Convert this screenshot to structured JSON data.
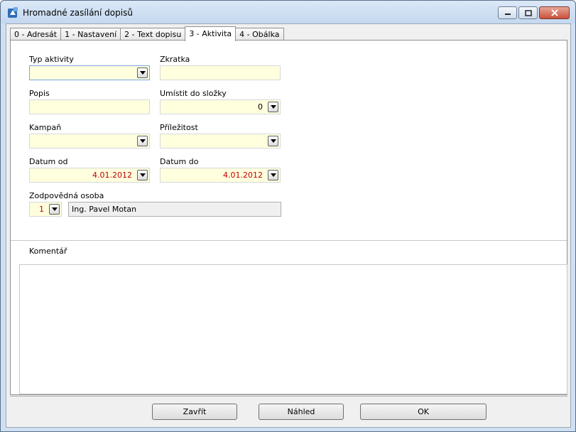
{
  "window": {
    "title": "Hromadné zasílání dopisů"
  },
  "tabs": [
    {
      "label": "0 - Adresát"
    },
    {
      "label": "1 - Nastavení"
    },
    {
      "label": "2 - Text dopisu"
    },
    {
      "label": "3 - Aktivita"
    },
    {
      "label": "4 - Obálka"
    }
  ],
  "active_tab": "3 - Aktivita",
  "form": {
    "typ_aktivity": {
      "label": "Typ aktivity",
      "value": ""
    },
    "zkratka": {
      "label": "Zkratka",
      "value": ""
    },
    "popis": {
      "label": "Popis",
      "value": ""
    },
    "umistit": {
      "label": "Umístit do složky",
      "value": "0"
    },
    "kampan": {
      "label": "Kampaň",
      "value": ""
    },
    "prilezitost": {
      "label": "Příležitost",
      "value": ""
    },
    "datum_od": {
      "label": "Datum od",
      "value": "4.01.2012"
    },
    "datum_do": {
      "label": "Datum do",
      "value": "4.01.2012"
    },
    "zodpovedna": {
      "label": "Zodpovědná osoba",
      "id": "1",
      "name": "Ing. Pavel Motan"
    },
    "komentar": {
      "label": "Komentář",
      "value": ""
    }
  },
  "buttons": {
    "zavrit": "Zavřít",
    "nahled": "Náhled",
    "ok": "OK"
  },
  "colors": {
    "field_bg": "#ffffde",
    "date_text": "#c00000",
    "title_bar": "#c4d8ef"
  },
  "icons": {
    "app": "app-icon",
    "dropdown": "chevron-down-icon",
    "minimize": "minimize-icon",
    "maximize": "maximize-icon",
    "close": "close-icon"
  }
}
